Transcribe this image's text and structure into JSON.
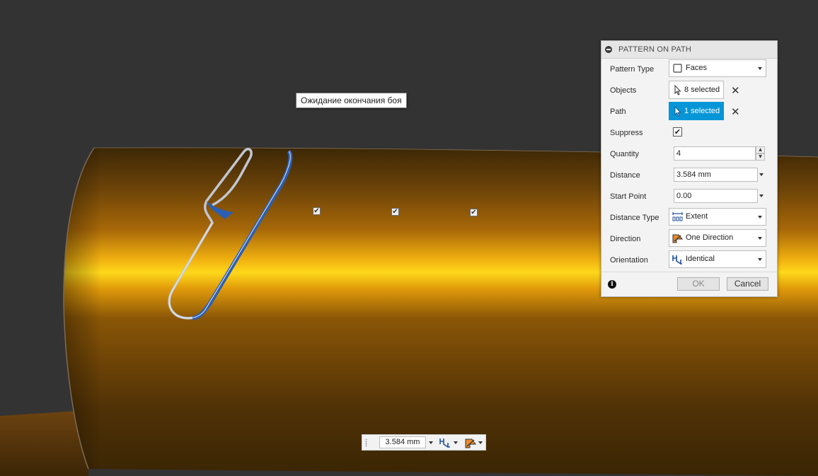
{
  "viewport": {
    "tooltip": "Ожидание окончания боя",
    "pattern_markers": [
      "✔",
      "✔",
      "✔"
    ],
    "colors": {
      "background": "#333333",
      "body_dark": "#3a2405",
      "body_highlight": "#ffd21a",
      "selection_blue": "#2a5fb0"
    }
  },
  "dialog": {
    "title": "PATTERN ON PATH",
    "pattern_type": {
      "label": "Pattern Type",
      "value": "Faces",
      "icon": "face-box-icon"
    },
    "objects": {
      "label": "Objects",
      "value": "8 selected",
      "clear": "✕",
      "icon": "cursor-icon"
    },
    "path": {
      "label": "Path",
      "value": "1 selected",
      "clear": "✕",
      "icon": "cursor-icon"
    },
    "suppress": {
      "label": "Suppress",
      "checked": "✔"
    },
    "quantity": {
      "label": "Quantity",
      "value": "4",
      "up": "▲",
      "down": "▼"
    },
    "distance": {
      "label": "Distance",
      "value": "3.584 mm"
    },
    "start_point": {
      "label": "Start Point",
      "value": "0.00"
    },
    "distance_type": {
      "label": "Distance Type",
      "value": "Extent",
      "icon": "extent-icon"
    },
    "direction": {
      "label": "Direction",
      "value": "One Direction",
      "icon": "one-direction-icon"
    },
    "orientation": {
      "label": "Orientation",
      "value": "Identical",
      "icon": "identical-icon"
    },
    "info": "i",
    "ok": "OK",
    "cancel": "Cancel",
    "accent": "#0696d7"
  },
  "mini_toolbar": {
    "distance": "3.584 mm"
  }
}
